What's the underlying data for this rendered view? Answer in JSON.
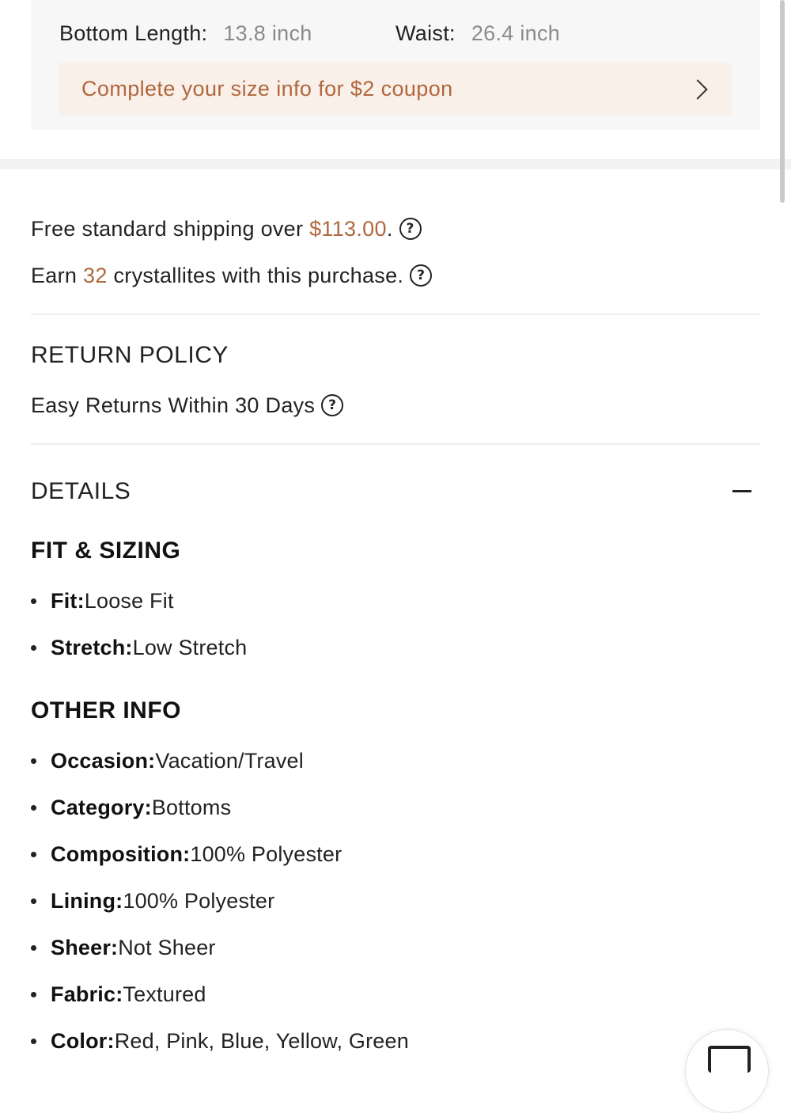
{
  "size_info": {
    "bottom_length_label": "Bottom Length:",
    "bottom_length_value": "13.8 inch",
    "waist_label": "Waist:",
    "waist_value": "26.4 inch",
    "coupon_text": "Complete your size info for $2 coupon"
  },
  "shipping": {
    "prefix": "Free standard shipping over ",
    "amount": "$113.00",
    "suffix": "."
  },
  "points": {
    "prefix": "Earn ",
    "count": "32",
    "suffix": " crystallites with this purchase."
  },
  "return_policy": {
    "title": "RETURN POLICY",
    "text": "Easy Returns Within 30 Days"
  },
  "details": {
    "title": "DETAILS",
    "fit_title": "FIT & SIZING",
    "fit_items": [
      {
        "key": "Fit:",
        "value": "Loose Fit"
      },
      {
        "key": "Stretch:",
        "value": "Low Stretch"
      }
    ],
    "other_title": "OTHER INFO",
    "other_items": [
      {
        "key": "Occasion:",
        "value": "Vacation/Travel"
      },
      {
        "key": "Category:",
        "value": "Bottoms"
      },
      {
        "key": "Composition:",
        "value": "100% Polyester"
      },
      {
        "key": "Lining:",
        "value": "100% Polyester"
      },
      {
        "key": "Sheer:",
        "value": "Not Sheer"
      },
      {
        "key": "Fabric:",
        "value": "Textured"
      },
      {
        "key": "Color:",
        "value": "Red, Pink, Blue, Yellow, Green"
      }
    ]
  },
  "help_icon_glyph": "?",
  "colors": {
    "accent": "#b0673d",
    "coupon_bg": "#faf0ea",
    "card_bg": "#f7f7f7"
  }
}
